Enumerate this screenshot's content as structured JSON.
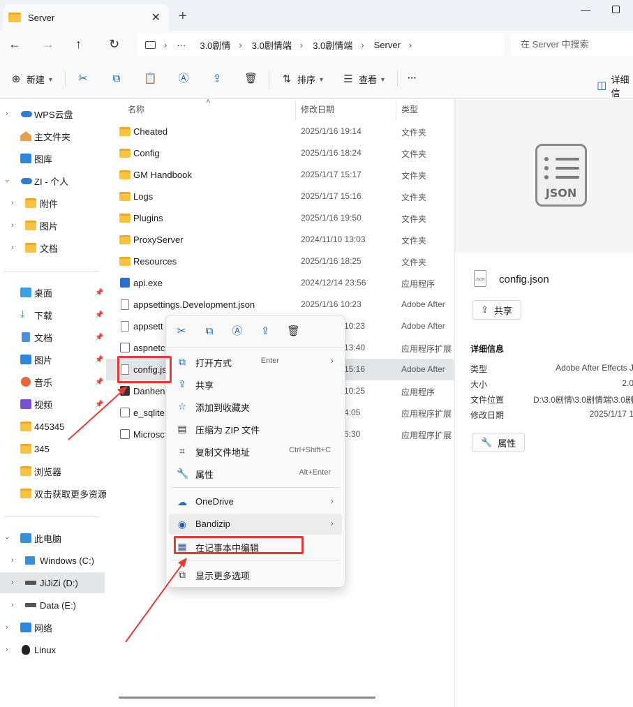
{
  "window": {
    "tab_title": "Server",
    "new_tab": "+",
    "close_tab": "✕",
    "minimize": "—"
  },
  "nav": {
    "breadcrumbs": [
      "3.0剧情",
      "3.0剧情端",
      "3.0剧情端",
      "Server"
    ],
    "ellipsis": "···",
    "search_placeholder": "在 Server 中搜索"
  },
  "toolbar": {
    "new_label": "新建",
    "sort_label": "排序",
    "view_label": "查看",
    "more_label": "···",
    "details_label": "详细信"
  },
  "sidebar": {
    "items": [
      {
        "label": "WPS云盘",
        "icon": "cloud-icon"
      },
      {
        "label": "主文件夹",
        "icon": "home-icon"
      },
      {
        "label": "图库",
        "icon": "gallery-icon"
      },
      {
        "label": "ZI - 个人",
        "icon": "onedrive-icon"
      },
      {
        "label": "附件",
        "icon": "folder-icon"
      },
      {
        "label": "图片",
        "icon": "folder-icon"
      },
      {
        "label": "文档",
        "icon": "folder-icon"
      },
      {
        "label": "桌面",
        "icon": "desktop-icon"
      },
      {
        "label": "下载",
        "icon": "download-icon"
      },
      {
        "label": "文档",
        "icon": "documents-icon"
      },
      {
        "label": "图片",
        "icon": "pictures-icon"
      },
      {
        "label": "音乐",
        "icon": "music-icon"
      },
      {
        "label": "视频",
        "icon": "video-icon"
      },
      {
        "label": "445345",
        "icon": "folder-icon"
      },
      {
        "label": "345",
        "icon": "folder-icon"
      },
      {
        "label": "浏览器",
        "icon": "folder-icon"
      },
      {
        "label": "双击获取更多资源",
        "icon": "folder-icon"
      },
      {
        "label": "此电脑",
        "icon": "pc-icon"
      },
      {
        "label": "Windows (C:)",
        "icon": "drive-icon"
      },
      {
        "label": "JiJiZi (D:)",
        "icon": "drive-icon"
      },
      {
        "label": "Data (E:)",
        "icon": "drive-icon"
      },
      {
        "label": "网络",
        "icon": "network-icon"
      },
      {
        "label": "Linux",
        "icon": "linux-icon"
      }
    ]
  },
  "filelist": {
    "headers": {
      "name": "名称",
      "date": "修改日期",
      "type": "类型"
    },
    "rows": [
      {
        "name": "Cheated",
        "date": "2025/1/16 19:14",
        "type": "文件夹"
      },
      {
        "name": "Config",
        "date": "2025/1/16 18:24",
        "type": "文件夹"
      },
      {
        "name": "GM Handbook",
        "date": "2025/1/17 15:17",
        "type": "文件夹"
      },
      {
        "name": "Logs",
        "date": "2025/1/17 15:16",
        "type": "文件夹"
      },
      {
        "name": "Plugins",
        "date": "2025/1/16 19:50",
        "type": "文件夹"
      },
      {
        "name": "ProxyServer",
        "date": "2024/11/10 13:03",
        "type": "文件夹"
      },
      {
        "name": "Resources",
        "date": "2025/1/16 18:25",
        "type": "文件夹"
      },
      {
        "name": "api.exe",
        "date": "2024/12/14 23:56",
        "type": "应用程序"
      },
      {
        "name": "appsettings.Development.json",
        "date": "2025/1/16 10:23",
        "type": "Adobe After"
      },
      {
        "name": "appsett",
        "date": "10:23",
        "type": "Adobe After"
      },
      {
        "name": "aspnetc",
        "date": "13:40",
        "type": "应用程序扩展"
      },
      {
        "name": "config.js",
        "date": "15:16",
        "type": "Adobe After"
      },
      {
        "name": "Danhen",
        "date": "10:25",
        "type": "应用程序"
      },
      {
        "name": "e_sqlite",
        "date": "4:05",
        "type": "应用程序扩展"
      },
      {
        "name": "Microsc",
        "date": "6:30",
        "type": "应用程序扩展"
      }
    ]
  },
  "details": {
    "preview_text": "JSON",
    "file_icon_text": "JSON",
    "filename": "config.json",
    "share_label": "共享",
    "section_title": "详细信息",
    "props": [
      {
        "label": "类型",
        "value": "Adobe After Effects J"
      },
      {
        "label": "大小",
        "value": "2.0"
      },
      {
        "label": "文件位置",
        "value": "D:\\3.0剧情\\3.0剧情端\\3.0剧"
      },
      {
        "label": "修改日期",
        "value": "2025/1/17 1"
      }
    ],
    "props_button": "属性"
  },
  "context_menu": {
    "items": [
      {
        "label": "打开方式",
        "shortcut": "Enter",
        "arrow": "›",
        "icon": "open-with-icon"
      },
      {
        "label": "共享",
        "shortcut": "",
        "arrow": "",
        "icon": "share-icon"
      },
      {
        "label": "添加到收藏夹",
        "shortcut": "",
        "arrow": "",
        "icon": "star-icon"
      },
      {
        "label": "压缩为 ZIP 文件",
        "shortcut": "",
        "arrow": "",
        "icon": "zip-icon"
      },
      {
        "label": "复制文件地址",
        "shortcut": "Ctrl+Shift+C",
        "arrow": "",
        "icon": "copy-path-icon"
      },
      {
        "label": "属性",
        "shortcut": "Alt+Enter",
        "arrow": "",
        "icon": "wrench-icon"
      },
      {
        "label": "OneDrive",
        "shortcut": "",
        "arrow": "›",
        "icon": "onedrive-icon"
      },
      {
        "label": "Bandizip",
        "shortcut": "",
        "arrow": "›",
        "icon": "bandizip-icon"
      },
      {
        "label": "在记事本中编辑",
        "shortcut": "",
        "arrow": "",
        "icon": "notepad-icon"
      },
      {
        "label": "显示更多选项",
        "shortcut": "",
        "arrow": "",
        "icon": "more-options-icon"
      }
    ]
  },
  "colors": {
    "accent": "#1f5fa8",
    "annotation_red": "#e53935",
    "folder_yellow": "#f6c342"
  }
}
